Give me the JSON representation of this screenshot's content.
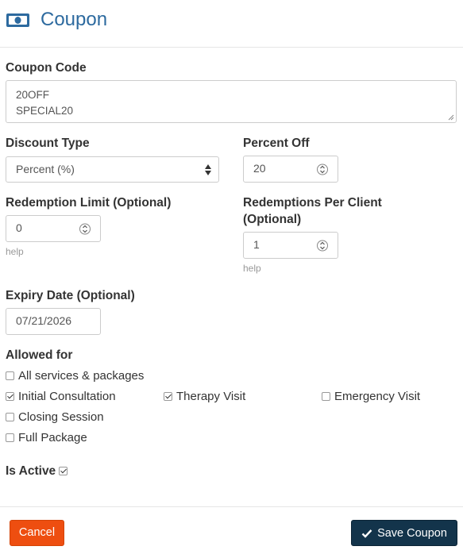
{
  "header": {
    "title": "Coupon",
    "icon": "money-bill-icon",
    "accent": "#2d6a9f"
  },
  "coupon_code": {
    "label": "Coupon Code",
    "lines": [
      "20OFF",
      "SPECIAL20"
    ]
  },
  "discount_type": {
    "label": "Discount Type",
    "value": "Percent (%)"
  },
  "percent_off": {
    "label": "Percent Off",
    "value": "20"
  },
  "redemption_limit": {
    "label": "Redemption Limit (Optional)",
    "value": "0",
    "help": "help"
  },
  "redemptions_per_client": {
    "label_line1": "Redemptions Per Client",
    "label_line2": "(Optional)",
    "value": "1",
    "help": "help"
  },
  "expiry_date": {
    "label": "Expiry Date (Optional)",
    "value": "07/21/2026"
  },
  "allowed_for": {
    "label": "Allowed for",
    "options": [
      {
        "label": "All services & packages",
        "checked": false
      },
      {
        "label": "Initial Consultation",
        "checked": true
      },
      {
        "label": "Therapy Visit",
        "checked": true
      },
      {
        "label": "Emergency Visit",
        "checked": false
      },
      {
        "label": "Closing Session",
        "checked": false
      },
      {
        "label": "Full Package",
        "checked": false
      }
    ]
  },
  "is_active": {
    "label": "Is Active",
    "checked": true
  },
  "footer": {
    "cancel_label": "Cancel",
    "save_label": "Save Coupon",
    "cancel_color": "#ee4e10",
    "save_color": "#13344b"
  }
}
